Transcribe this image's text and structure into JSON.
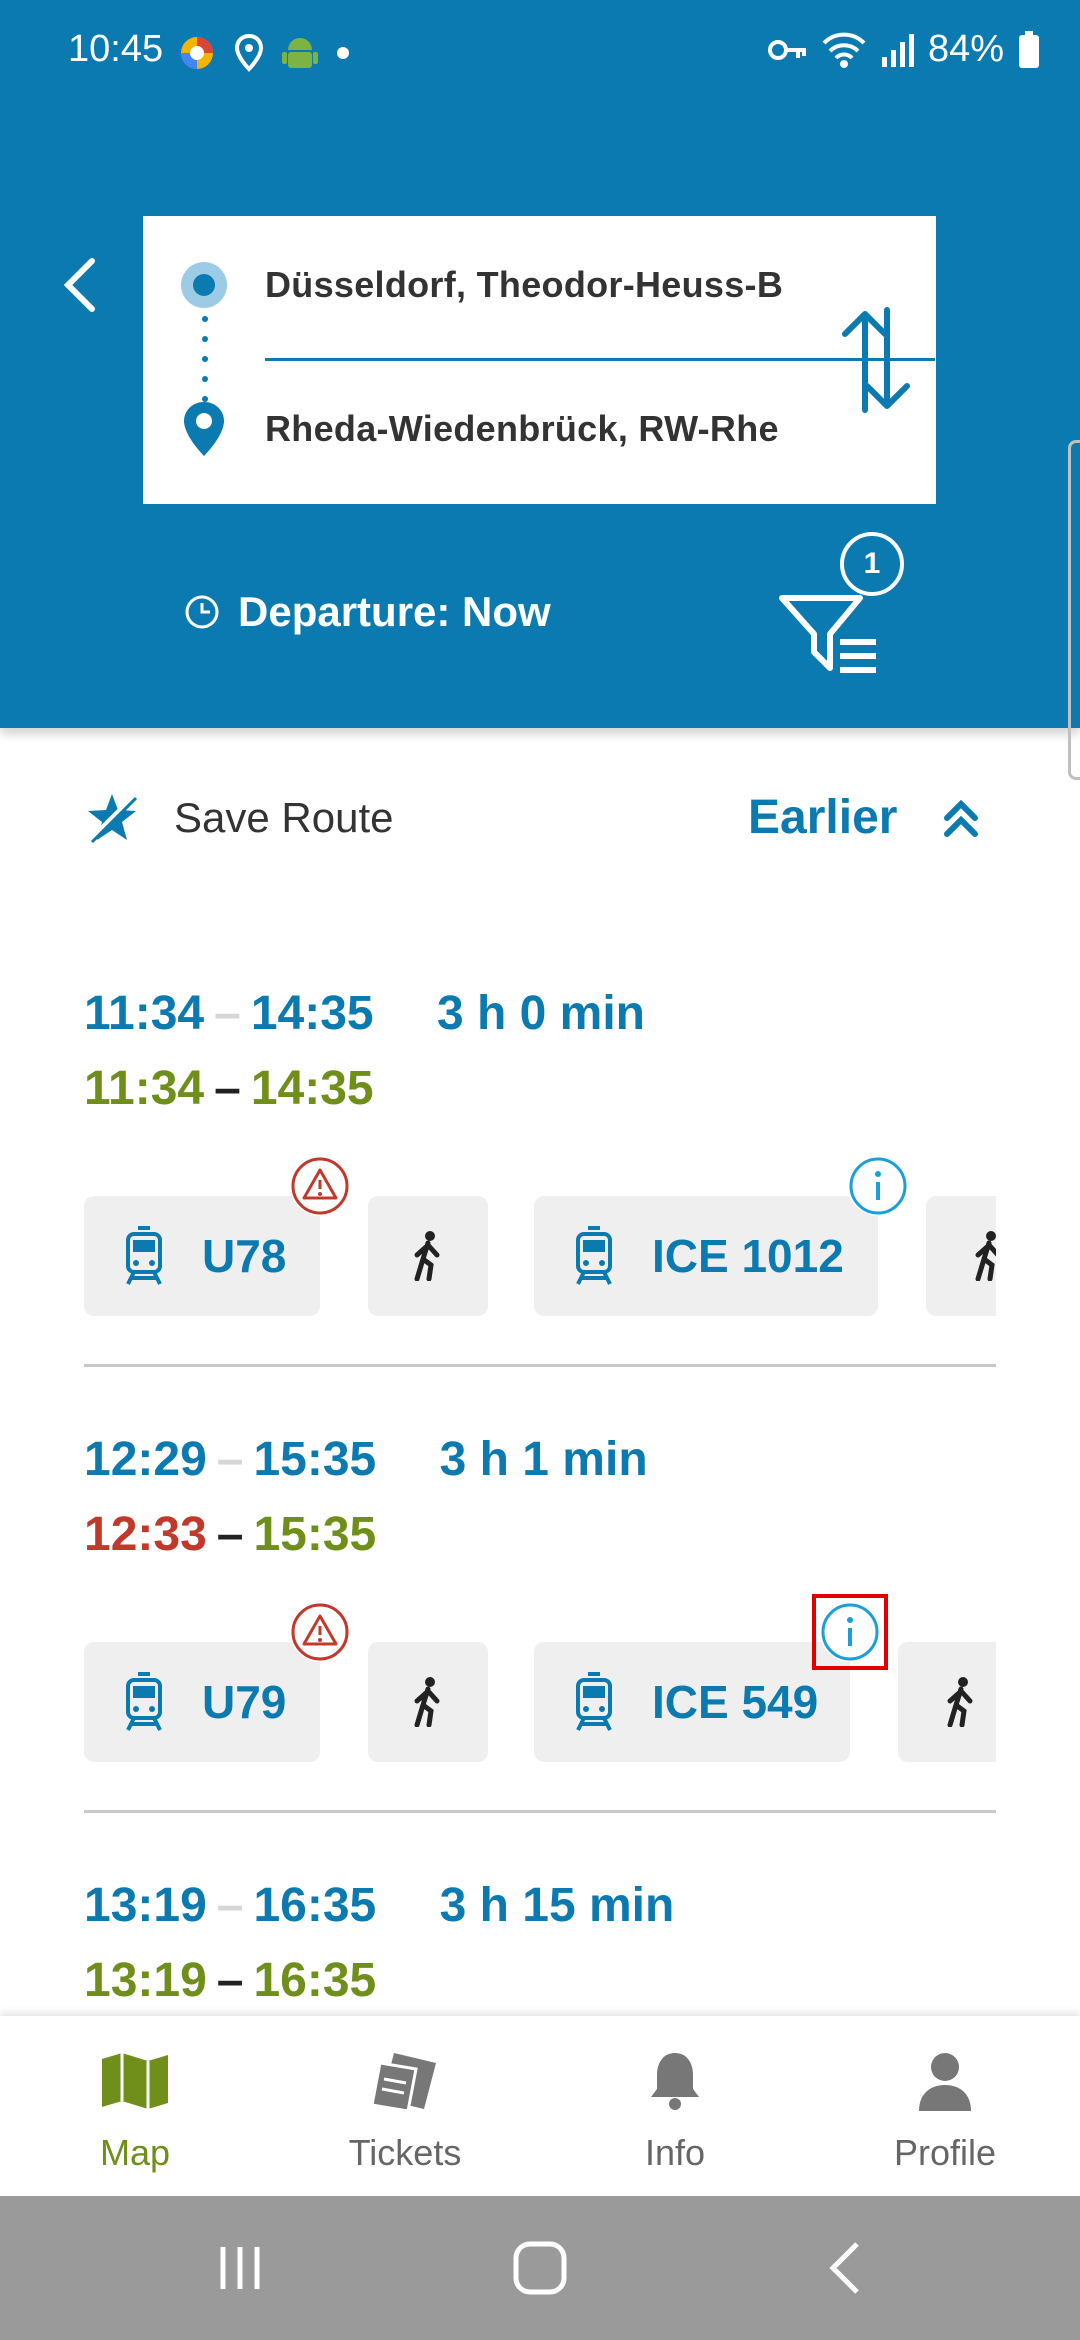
{
  "status_bar": {
    "time": "10:45",
    "battery": "84%"
  },
  "search": {
    "from": "Düsseldorf, Theodor-Heuss-B",
    "to": "Rheda-Wiedenbrück, RW-Rhe",
    "departure": "Departure: Now",
    "filter_count": "1"
  },
  "actions": {
    "save_route": "Save Route",
    "earlier": "Earlier"
  },
  "connections": [
    {
      "planned_dep": "11:34",
      "planned_arr": "14:35",
      "duration": "3 h 0 min",
      "actual_dep": "11:34",
      "actual_arr": "14:35",
      "dep_delayed": false,
      "legs": [
        "U78",
        "ICE 1012"
      ]
    },
    {
      "planned_dep": "12:29",
      "planned_arr": "15:35",
      "duration": "3 h 1 min",
      "actual_dep": "12:33",
      "actual_arr": "15:35",
      "dep_delayed": true,
      "legs": [
        "U79",
        "ICE 549"
      ]
    },
    {
      "planned_dep": "13:19",
      "planned_arr": "16:35",
      "duration": "3 h 15 min",
      "actual_dep": "13:19",
      "actual_arr": "16:35",
      "dep_delayed": false,
      "legs": []
    }
  ],
  "nav": {
    "map": "Map",
    "tickets": "Tickets",
    "info": "Info",
    "profile": "Profile"
  },
  "colors": {
    "primary": "#0b7ab0",
    "on_time": "#6f8f1a",
    "delayed": "#c0392b",
    "warning": "#c0392b",
    "chip_bg": "#efefef"
  }
}
